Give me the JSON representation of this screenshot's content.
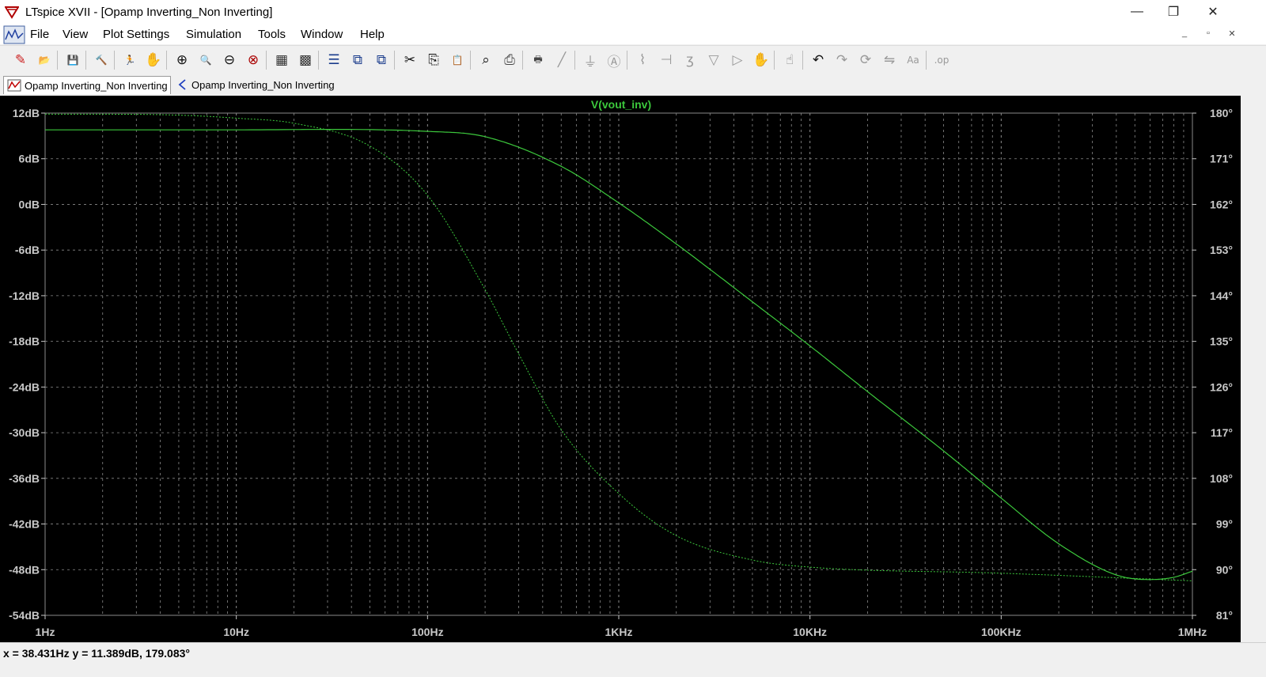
{
  "window": {
    "title": "LTspice XVII - [Opamp Inverting_Non Inverting]",
    "minimize": "—",
    "restore": "❐",
    "close": "✕"
  },
  "menu": {
    "items": [
      "File",
      "View",
      "Plot Settings",
      "Simulation",
      "Tools",
      "Window",
      "Help"
    ],
    "mdi_minimize": "_",
    "mdi_restore": "▫",
    "mdi_close": "✕"
  },
  "toolbar": {
    "buttons": [
      {
        "name": "new-schematic-icon",
        "glyph": "✎",
        "color": "#cc2222"
      },
      {
        "name": "open-icon",
        "glyph": "📂",
        "color": "#c8a020"
      },
      {
        "name": "save-icon",
        "glyph": "💾",
        "color": "#333333"
      },
      {
        "name": "control-panel-icon",
        "glyph": "🔨",
        "color": "#333333"
      },
      {
        "name": "run-icon",
        "glyph": "🏃",
        "color": "#111111"
      },
      {
        "name": "halt-icon",
        "glyph": "✋",
        "color": "#777777"
      },
      {
        "name": "zoom-area-icon",
        "glyph": "⊕",
        "color": "#111111"
      },
      {
        "name": "pan-icon",
        "glyph": "🔍",
        "color": "#111111"
      },
      {
        "name": "zoom-out-icon",
        "glyph": "⊖",
        "color": "#111111"
      },
      {
        "name": "zoom-fit-icon",
        "glyph": "⊗",
        "color": "#aa0000"
      },
      {
        "name": "autorange-icon",
        "glyph": "▦",
        "color": "#333333"
      },
      {
        "name": "grid-icon",
        "glyph": "▩",
        "color": "#333333"
      },
      {
        "name": "tile-horizontal-icon",
        "glyph": "☰",
        "color": "#1a3c8c"
      },
      {
        "name": "tile-vertical-icon",
        "glyph": "⧉",
        "color": "#1a3c8c"
      },
      {
        "name": "cascade-icon",
        "glyph": "⧉",
        "color": "#1a3c8c"
      },
      {
        "name": "cut-icon",
        "glyph": "✂",
        "color": "#111111"
      },
      {
        "name": "copy-icon",
        "glyph": "⎘",
        "color": "#111111"
      },
      {
        "name": "paste-icon",
        "glyph": "📋",
        "color": "#555555"
      },
      {
        "name": "find-icon",
        "glyph": "⌕",
        "color": "#111111"
      },
      {
        "name": "print-preview-icon",
        "glyph": "⎙",
        "color": "#444444"
      },
      {
        "name": "print-icon",
        "glyph": "🖶",
        "color": "#444444"
      },
      {
        "name": "wire-icon",
        "glyph": "╱",
        "color": "#999999"
      },
      {
        "name": "ground-icon",
        "glyph": "⏚",
        "color": "#999999"
      },
      {
        "name": "label-icon",
        "glyph": "Ⓐ",
        "color": "#999999"
      },
      {
        "name": "resistor-icon",
        "glyph": "⌇",
        "color": "#999999"
      },
      {
        "name": "capacitor-icon",
        "glyph": "⊣",
        "color": "#999999"
      },
      {
        "name": "inductor-icon",
        "glyph": "ʒ",
        "color": "#999999"
      },
      {
        "name": "diode-icon",
        "glyph": "▽",
        "color": "#999999"
      },
      {
        "name": "component-icon",
        "glyph": "▷",
        "color": "#999999"
      },
      {
        "name": "move-icon",
        "glyph": "✋",
        "color": "#777777"
      },
      {
        "name": "drag-icon",
        "glyph": "☝",
        "color": "#777777"
      },
      {
        "name": "undo-icon",
        "glyph": "↶",
        "color": "#111111"
      },
      {
        "name": "redo-icon",
        "glyph": "↷",
        "color": "#999999"
      },
      {
        "name": "rotate-icon",
        "glyph": "⟳",
        "color": "#999999"
      },
      {
        "name": "mirror-icon",
        "glyph": "⇋",
        "color": "#999999"
      },
      {
        "name": "text-icon",
        "glyph": "Aa",
        "color": "#999999"
      },
      {
        "name": "spice-directive-icon",
        "glyph": ".op",
        "color": "#999999"
      }
    ]
  },
  "tabs": [
    {
      "label": "Opamp Inverting_Non Inverting",
      "icon": "waveform-icon",
      "active": true
    },
    {
      "label": "Opamp Inverting_Non Inverting",
      "icon": "schematic-icon",
      "active": false
    }
  ],
  "plot": {
    "trace_label": "V(vout_inv)",
    "background": "#000000",
    "trace_color": "#3cc83c",
    "axis_text_color": "#c8c8c8",
    "grid_color": "#8a8a8a"
  },
  "chart_data": {
    "type": "line",
    "title": "V(vout_inv)",
    "x_scale": "log",
    "x_ticks": [
      "1Hz",
      "10Hz",
      "100Hz",
      "1KHz",
      "10KHz",
      "100KHz",
      "1MHz"
    ],
    "xlim": [
      1,
      1000000
    ],
    "y_left_ticks": [
      "12dB",
      "6dB",
      "0dB",
      "-6dB",
      "-12dB",
      "-18dB",
      "-24dB",
      "-30dB",
      "-36dB",
      "-42dB",
      "-48dB",
      "-54dB"
    ],
    "ylim_left": [
      -54,
      12
    ],
    "y_right_ticks": [
      "180°",
      "171°",
      "162°",
      "153°",
      "144°",
      "135°",
      "126°",
      "117°",
      "108°",
      "99°",
      "90°",
      "81°"
    ],
    "ylim_right": [
      81,
      180
    ],
    "grid": true,
    "series": [
      {
        "kind": "magnitude",
        "axis": "left",
        "x": [
          1,
          10,
          100,
          200,
          500,
          1000,
          2000,
          5000,
          10000,
          20000,
          50000,
          100000,
          200000,
          400000,
          600000,
          800000,
          1000000
        ],
        "y": [
          9.8,
          9.8,
          9.6,
          8.9,
          5.0,
          0.2,
          -5.2,
          -12.8,
          -18.6,
          -24.6,
          -32.4,
          -38.6,
          -44.6,
          -48.7,
          -49.3,
          -49.0,
          -48.2
        ]
      },
      {
        "kind": "phase",
        "axis": "right",
        "x": [
          1,
          5,
          10,
          20,
          50,
          100,
          200,
          300,
          500,
          1000,
          2000,
          5000,
          10000,
          100000,
          1000000
        ],
        "y": [
          179.8,
          179.6,
          179.0,
          178.0,
          173.5,
          163.8,
          145.2,
          132.5,
          117.6,
          105.0,
          96.7,
          91.9,
          90.5,
          89.3,
          87.8
        ]
      }
    ]
  },
  "status": {
    "text": "x = 38.431Hz    y = 11.389dB, 179.083°"
  }
}
